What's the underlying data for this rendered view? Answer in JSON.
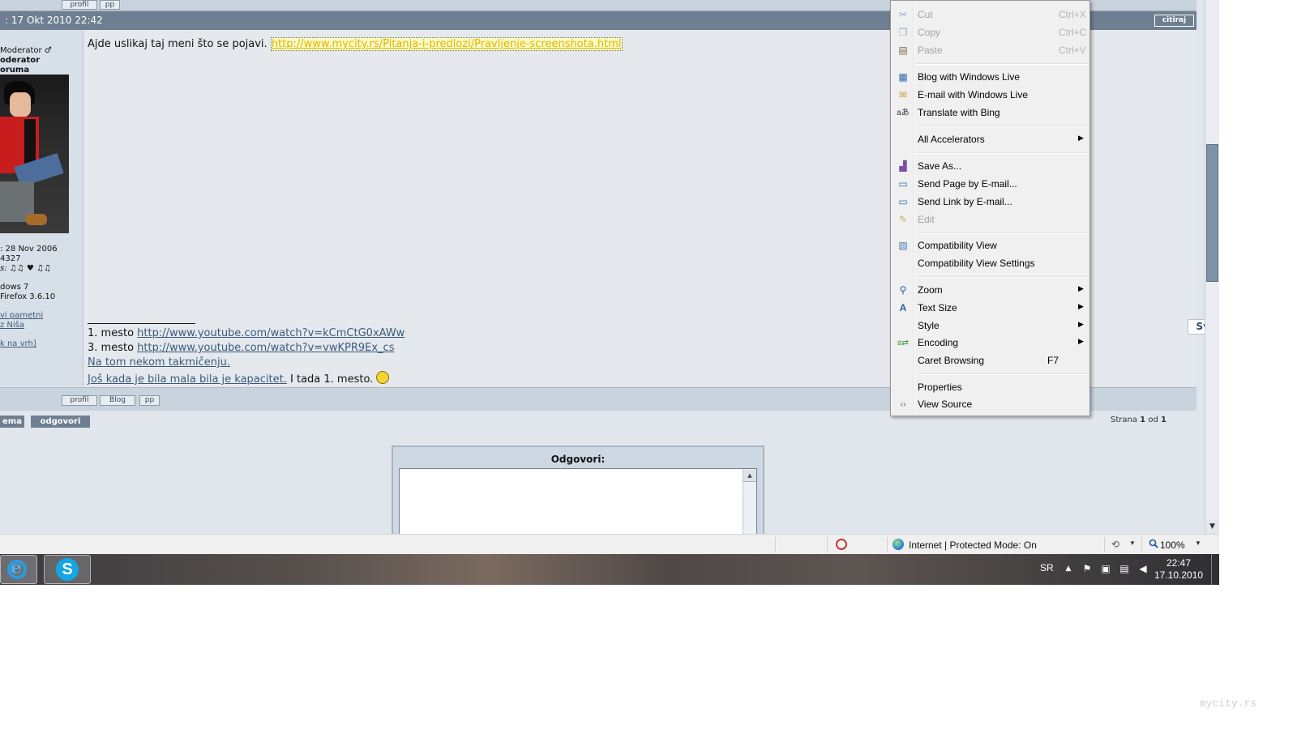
{
  "forum": {
    "top_buttons": [
      "profil",
      "pp"
    ],
    "post_date": ": 17 Okt 2010 22:42",
    "quote_label": "citiraj",
    "user": {
      "role_line": "Moderator ♂",
      "rank_line1": "oderator",
      "rank_line2": "oruma",
      "joined": ": 28 Nov 2006",
      "posts": "4327",
      "status": "s: ♫♫ ♥ ♫♫",
      "os": "dows 7",
      "browser": "Firefox 3.6.10",
      "link1": "vi pametni",
      "link2": "z Niša",
      "back_top": "k na vrh]"
    },
    "post_text": "Ajde uslikaj taj meni što se pojavi.",
    "post_link": "http://www.mycity.rs/Pitanja-i-predlozi/Pravljenje-screenshota.html",
    "signature": {
      "line1_prefix": "1. mesto",
      "line1_link": "http://www.youtube.com/watch?v=kCmCtG0xAWw",
      "line2_prefix": "3. mesto",
      "line2_link": "http://www.youtube.com/watch?v=vwKPR9Ex_cs",
      "line3_link": "Na tom nekom takmičenju.",
      "line4_link": "Još kada je bila mala bila je kapacitet.",
      "line4_text": "I tada 1. mesto."
    },
    "like_button": "Sviđa mi se!",
    "footer_buttons": [
      "profil",
      "Blog",
      "pp"
    ],
    "tema_button": "ema",
    "reply_button": "odgovori",
    "page_info": {
      "prefix": "Strana",
      "current": "1",
      "sep": "od",
      "total": "1"
    },
    "reply_box_title": "Odgovori:"
  },
  "context_menu": {
    "items": [
      {
        "label": "Cut",
        "shortcut": "Ctrl+X",
        "disabled": true,
        "icon": "scissors-icon"
      },
      {
        "label": "Copy",
        "shortcut": "Ctrl+C",
        "disabled": true,
        "icon": "copy-icon"
      },
      {
        "label": "Paste",
        "shortcut": "Ctrl+V",
        "disabled": true,
        "icon": "clipboard-icon"
      },
      {
        "label": "Blog with Windows Live",
        "icon": "blog-icon"
      },
      {
        "label": "E-mail with Windows Live",
        "icon": "email-icon"
      },
      {
        "label": "Translate with Bing",
        "icon": "translate-icon"
      },
      {
        "label": "All Accelerators",
        "submenu": true
      },
      {
        "label": "Save As...",
        "icon": "save-icon"
      },
      {
        "label": "Send Page by E-mail...",
        "icon": "send-page-icon"
      },
      {
        "label": "Send Link by E-mail...",
        "icon": "send-link-icon"
      },
      {
        "label": "Edit",
        "disabled": true,
        "icon": "pencil-icon"
      },
      {
        "label": "Compatibility View",
        "icon": "compat-icon"
      },
      {
        "label": "Compatibility View Settings"
      },
      {
        "label": "Zoom",
        "submenu": true,
        "icon": "zoom-icon"
      },
      {
        "label": "Text Size",
        "submenu": true,
        "icon": "text-size-icon"
      },
      {
        "label": "Style",
        "submenu": true
      },
      {
        "label": "Encoding",
        "submenu": true,
        "icon": "encoding-icon"
      },
      {
        "label": "Caret Browsing",
        "shortcut": "F7"
      },
      {
        "label": "Properties"
      },
      {
        "label": "View Source",
        "icon": "view-source-icon"
      }
    ]
  },
  "statusbar": {
    "zone_text": "Internet | Protected Mode: On",
    "zoom_text": "100%"
  },
  "taskbar": {
    "language": "SR",
    "time": "22:47",
    "date": "17.10.2010"
  },
  "watermark": "mycity.rs"
}
